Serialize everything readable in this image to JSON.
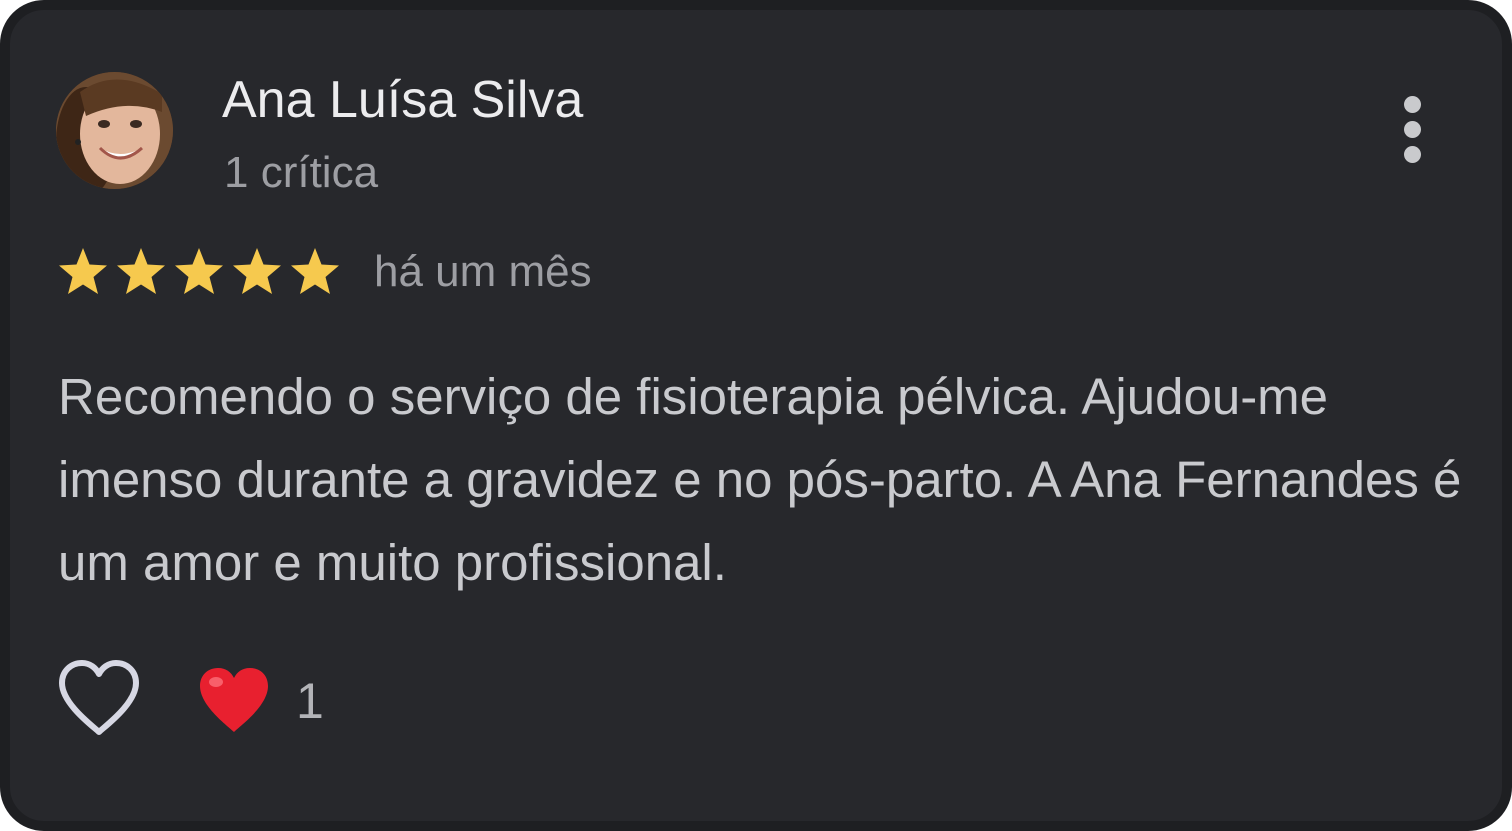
{
  "review": {
    "author_name": "Ana Luísa Silva",
    "author_review_count": "1 crítica",
    "rating": 5,
    "max_rating": 5,
    "date": "há um mês",
    "text": "Recomendo o serviço de fisioterapia pélvica. Ajudou-me imenso durante a gravidez e no pós-parto. A Ana Fernandes é um amor e muito profissional.",
    "reaction_count": "1"
  },
  "icons": {
    "avatar": "profile-photo",
    "more": "more-vertical-icon",
    "star": "star-icon",
    "like": "heart-outline-icon",
    "reaction": "red-heart-icon"
  },
  "colors": {
    "card_background": "#27282c",
    "star": "#f6c94e",
    "reaction_heart": "#e8202f",
    "primary_text": "#ececee",
    "secondary_text": "#9d9ea3"
  }
}
